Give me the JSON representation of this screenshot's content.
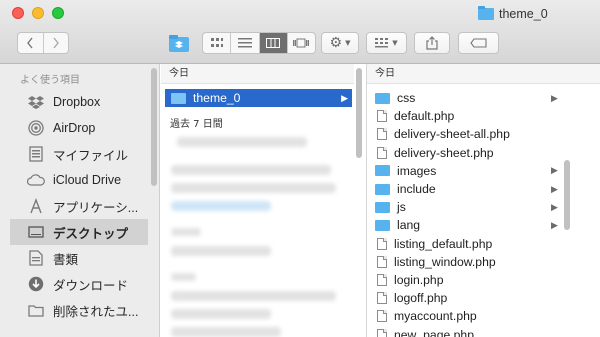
{
  "window": {
    "title": "theme_0"
  },
  "sidebar": {
    "section": "よく使う項目",
    "items": [
      {
        "label": "Dropbox",
        "icon": "dropbox-icon"
      },
      {
        "label": "AirDrop",
        "icon": "airdrop-icon"
      },
      {
        "label": "マイファイル",
        "icon": "all-my-files-icon"
      },
      {
        "label": "iCloud Drive",
        "icon": "cloud-icon"
      },
      {
        "label": "アプリケーシ...",
        "icon": "applications-icon"
      },
      {
        "label": "デスクトップ",
        "icon": "desktop-icon",
        "selected": true
      },
      {
        "label": "書類",
        "icon": "documents-icon"
      },
      {
        "label": "ダウンロード",
        "icon": "downloads-icon"
      },
      {
        "label": "削除されたユ...",
        "icon": "folder-icon"
      }
    ]
  },
  "column1": {
    "header": "今日",
    "selected_item": "theme_0",
    "group2": "過去 7 日間"
  },
  "column2": {
    "header": "今日",
    "items": [
      {
        "name": "css",
        "type": "folder"
      },
      {
        "name": "default.php",
        "type": "file"
      },
      {
        "name": "delivery-sheet-all.php",
        "type": "file"
      },
      {
        "name": "delivery-sheet.php",
        "type": "file"
      },
      {
        "name": "images",
        "type": "folder"
      },
      {
        "name": "include",
        "type": "folder"
      },
      {
        "name": "js",
        "type": "folder"
      },
      {
        "name": "lang",
        "type": "folder"
      },
      {
        "name": "listing_default.php",
        "type": "file"
      },
      {
        "name": "listing_window.php",
        "type": "file"
      },
      {
        "name": "login.php",
        "type": "file"
      },
      {
        "name": "logoff.php",
        "type": "file"
      },
      {
        "name": "myaccount.php",
        "type": "file"
      },
      {
        "name": "new_page.php",
        "type": "file"
      }
    ]
  },
  "colors": {
    "selection": "#2a69cc",
    "folder": "#56b3ee"
  }
}
